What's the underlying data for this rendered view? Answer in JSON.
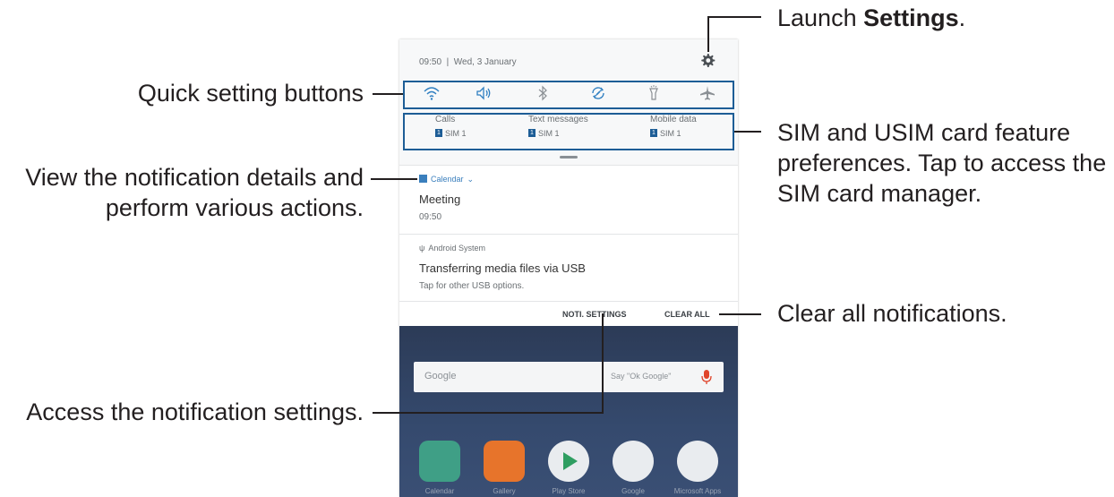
{
  "status": {
    "time": "09:50",
    "date": "Wed, 3 January"
  },
  "quick_settings": [
    "wifi-icon",
    "sound-icon",
    "bluetooth-icon",
    "auto-rotate-icon",
    "flashlight-icon",
    "airplane-mode-icon"
  ],
  "sim": [
    {
      "title": "Calls",
      "sub": "SIM 1",
      "num": "1"
    },
    {
      "title": "Text messages",
      "sub": "SIM 1",
      "num": "1"
    },
    {
      "title": "Mobile data",
      "sub": "SIM 1",
      "num": "1"
    }
  ],
  "notifications": [
    {
      "app": "Calendar",
      "title": "Meeting",
      "sub": "09:50"
    },
    {
      "app": "Android System",
      "title": "Transferring media files via USB",
      "sub": "Tap for other USB options."
    }
  ],
  "actions": {
    "noti_settings": "NOTI. SETTINGS",
    "clear_all": "CLEAR ALL"
  },
  "home": {
    "search_logo": "Google",
    "search_hint": "Say \"Ok Google\"",
    "apps": [
      "Calendar",
      "Gallery",
      "Play Store",
      "Google",
      "Microsoft Apps"
    ]
  },
  "callouts": {
    "launch_prefix": "Launch ",
    "launch_bold": "Settings",
    "launch_suffix": ".",
    "quick": "Quick setting buttons",
    "sim_1": "SIM and USIM card feature",
    "sim_2": "preferences. Tap to access the",
    "sim_3": "SIM card manager.",
    "view_1": "View the notification details and",
    "view_2": "perform various actions.",
    "clear": "Clear all notifications.",
    "access": "Access the notification settings."
  },
  "colors": {
    "accent": "#3a7fbd",
    "callout_box": "#1d5d96",
    "home_bg": "#354a6e"
  }
}
